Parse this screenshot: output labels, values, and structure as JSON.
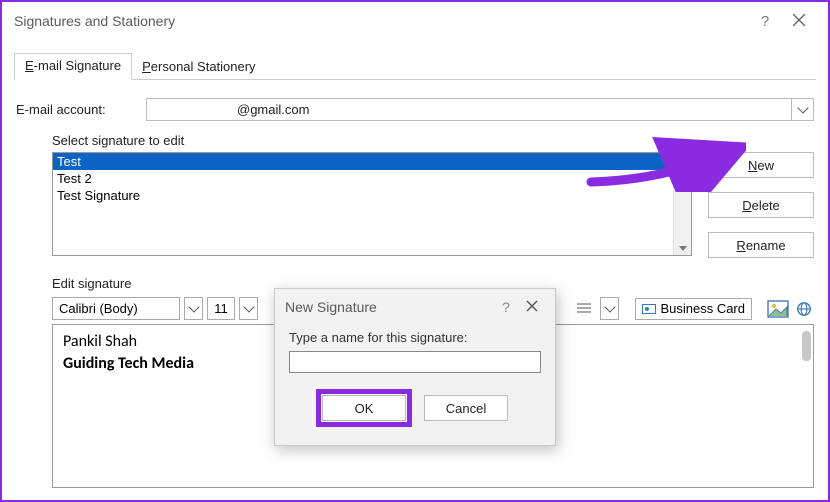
{
  "window_title": "Signatures and Stationery",
  "tabs": {
    "email": "E-mail Signature",
    "personal": "Personal Stationery"
  },
  "emailAccountLabel": "E-mail account:",
  "emailAccount": "@gmail.com",
  "selectLabel": "Select signature to edit",
  "signatures": [
    "Test",
    "Test 2",
    "Test Signature"
  ],
  "buttons": {
    "new": "New",
    "delete": "Delete",
    "rename": "Rename"
  },
  "editLabel": "Edit signature",
  "toolbar": {
    "font": "Calibri (Body)",
    "size": "11",
    "bizcard": "Business Card"
  },
  "editor": {
    "line1": "Pankil Shah",
    "line2": "Guiding Tech Media"
  },
  "modal": {
    "title": "New Signature",
    "label": "Type a name for this signature:",
    "ok": "OK",
    "cancel": "Cancel"
  }
}
